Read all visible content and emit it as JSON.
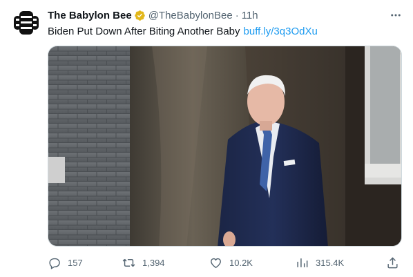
{
  "tweet": {
    "author_name": "The Babylon Bee",
    "handle": "@TheBabylonBee",
    "separator": "·",
    "time": "11h",
    "text": "Biden Put Down After Biting Another Baby",
    "link": "buff.ly/3q3OdXu",
    "verified_badge_color": "#e2b719",
    "link_color": "#1d9bf0"
  },
  "actions": {
    "replies": "157",
    "retweets": "1,394",
    "likes": "10.2K",
    "views": "315.4K"
  },
  "icons": {
    "avatar": "babylon-bee-logo-icon",
    "verified": "verified-badge-icon",
    "more": "more-options-icon",
    "reply": "reply-icon",
    "retweet": "retweet-icon",
    "like": "heart-icon",
    "views": "views-chart-icon",
    "share": "share-icon"
  }
}
